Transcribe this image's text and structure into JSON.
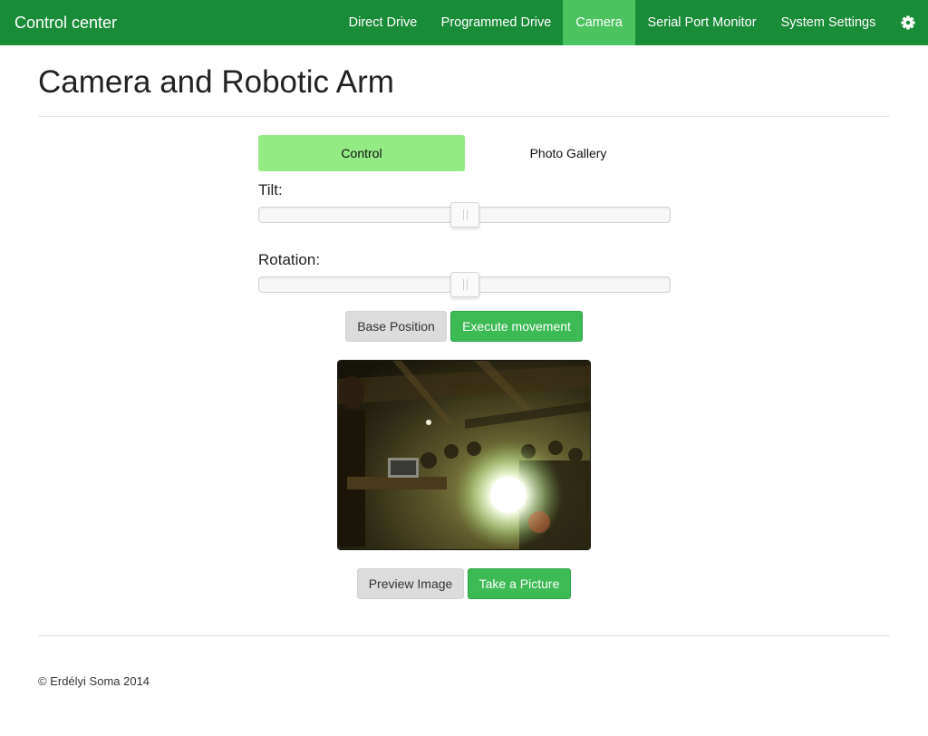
{
  "navbar": {
    "brand": "Control center",
    "items": [
      {
        "label": "Direct Drive",
        "active": false
      },
      {
        "label": "Programmed Drive",
        "active": false
      },
      {
        "label": "Camera",
        "active": true
      },
      {
        "label": "Serial Port Monitor",
        "active": false
      },
      {
        "label": "System Settings",
        "active": false
      }
    ],
    "settings_icon": "gear-icon"
  },
  "page": {
    "title": "Camera and Robotic Arm"
  },
  "tabs": [
    {
      "label": "Control",
      "active": true
    },
    {
      "label": "Photo Gallery",
      "active": false
    }
  ],
  "controls": {
    "tilt": {
      "label": "Tilt:",
      "value_fraction": 0.5
    },
    "rotation": {
      "label": "Rotation:",
      "value_fraction": 0.5
    },
    "base_position_button": "Base Position",
    "execute_button": "Execute movement"
  },
  "camera": {
    "preview_button": "Preview Image",
    "take_picture_button": "Take a Picture"
  },
  "footer": {
    "text": "© Erdélyi Soma 2014"
  },
  "colors": {
    "navbar": "#198c37",
    "nav_active": "#4bc35f",
    "tab_active": "#94ea85",
    "success": "#3cba54",
    "default_button": "#dcdcdc"
  }
}
